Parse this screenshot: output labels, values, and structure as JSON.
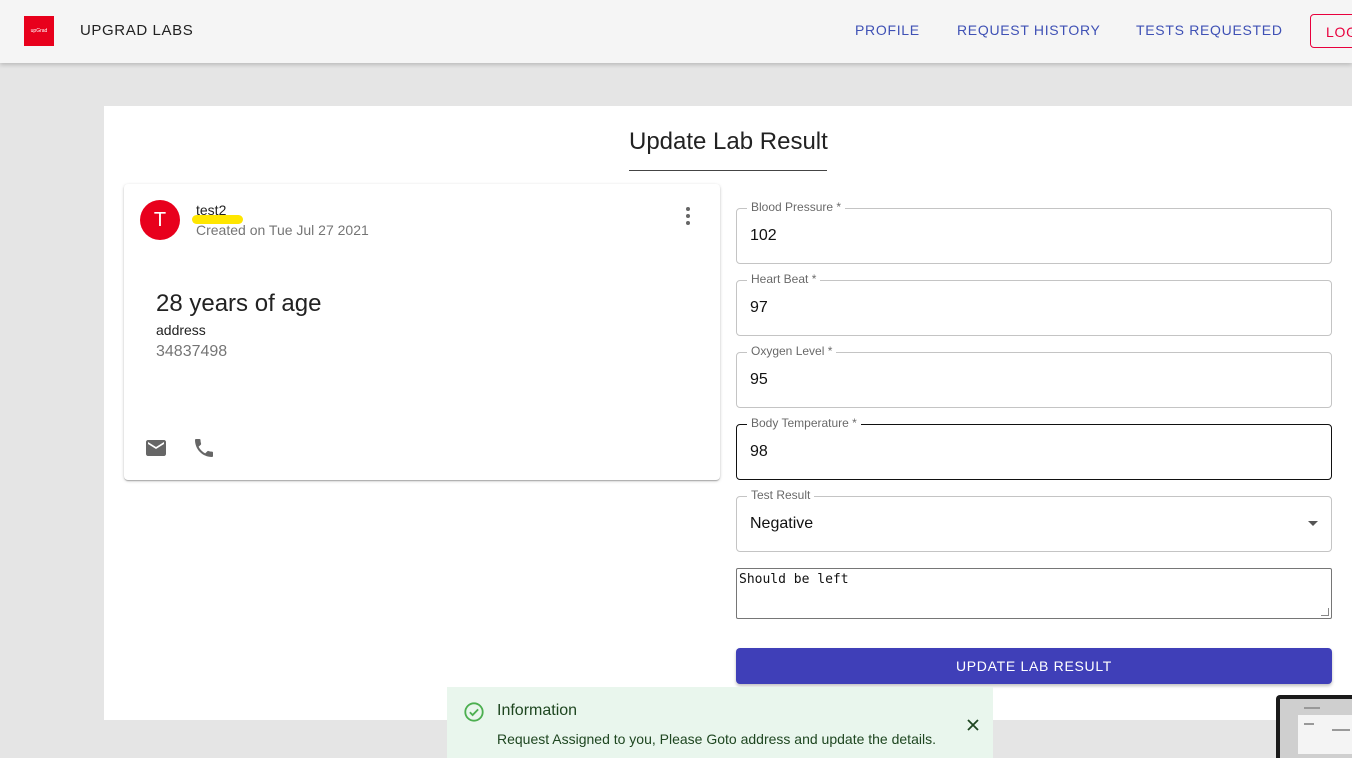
{
  "header": {
    "logo_text": "upGrad",
    "brand": "UPGRAD LABS",
    "nav": [
      "PROFILE",
      "REQUEST HISTORY",
      "TESTS REQUESTED"
    ],
    "logout_label": "LOGOUT"
  },
  "page": {
    "title": "Update Lab Result"
  },
  "patient": {
    "avatar_letter": "T",
    "name": "test2",
    "created": "Created on Tue Jul 27 2021",
    "age": "28 years of age",
    "address_label": "address",
    "address_value": "34837498"
  },
  "form": {
    "fields": [
      {
        "label": "Blood Pressure *",
        "value": "102"
      },
      {
        "label": "Heart Beat *",
        "value": "97"
      },
      {
        "label": "Oxygen Level *",
        "value": "95"
      },
      {
        "label": "Body Temperature *",
        "value": "98"
      },
      {
        "label": "Test Result",
        "value": "Negative"
      }
    ],
    "notes": "Should be left",
    "submit_label": "UPDATE LAB RESULT"
  },
  "toast": {
    "title": "Information",
    "message": "Request Assigned to you, Please Goto address and update the details."
  },
  "colors": {
    "brand_red": "#e8001c",
    "primary": "#3f3fb8",
    "nav_blue": "#3f51b5",
    "success_bg": "#e9f6ed"
  }
}
